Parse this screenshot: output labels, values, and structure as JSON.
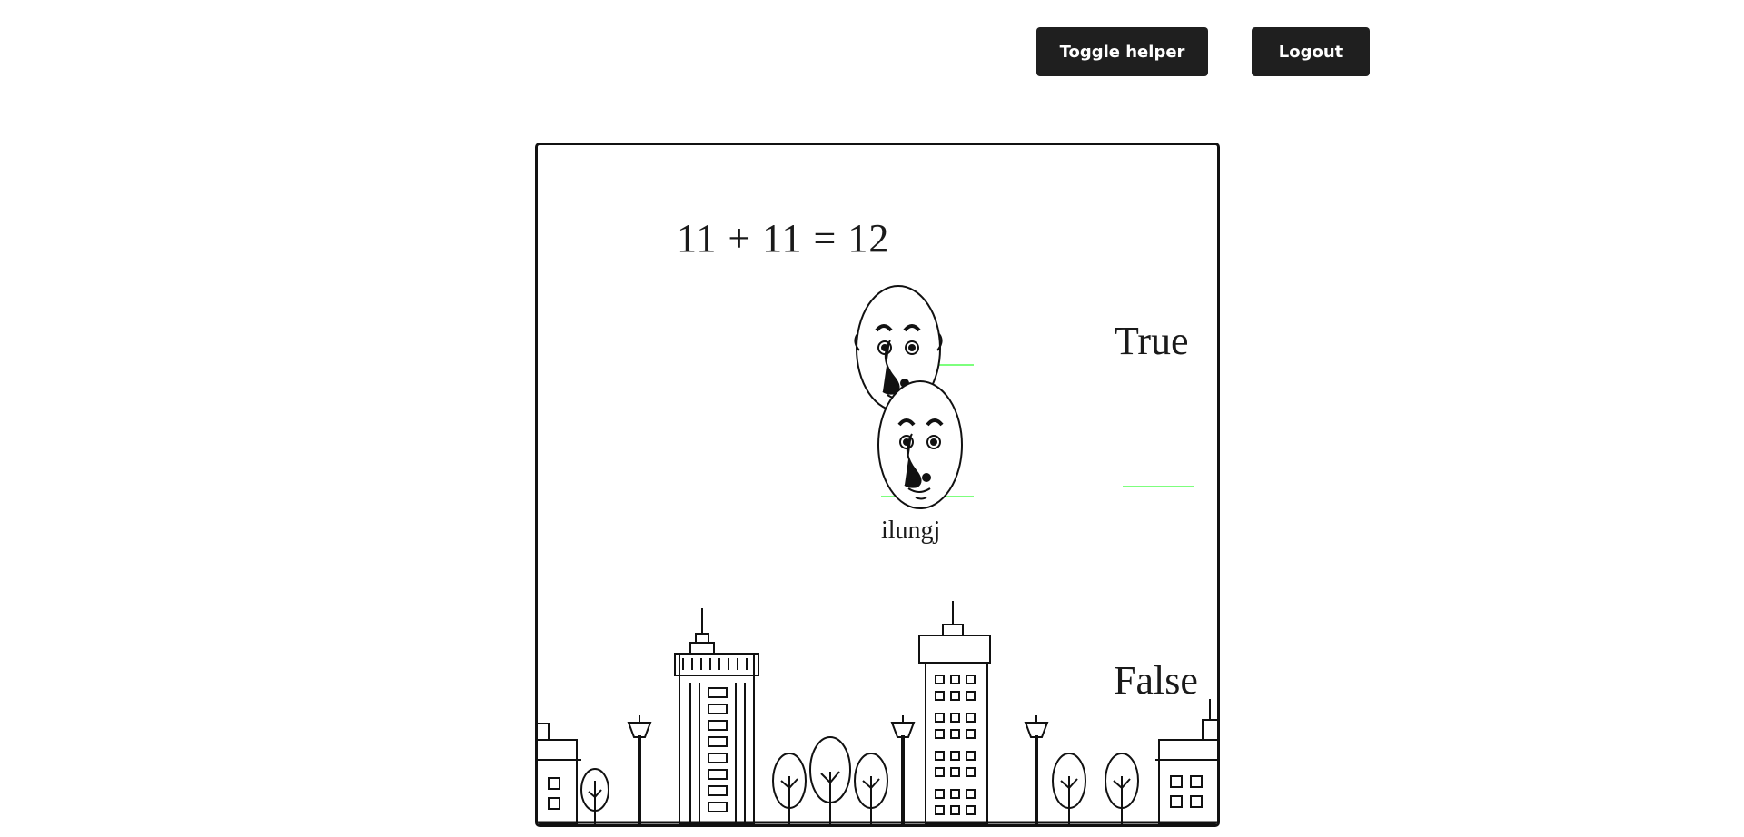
{
  "header": {
    "toggle_label": "Toggle helper",
    "logout_label": "Logout"
  },
  "game": {
    "question": "11 + 11 = 12",
    "options": {
      "true_label": "True",
      "false_label": "False"
    },
    "player_name": "ilungj",
    "colors": {
      "helper_line": "#7dff7d",
      "button_bg": "#1f1f1f",
      "ink": "#1a1a1a"
    }
  }
}
